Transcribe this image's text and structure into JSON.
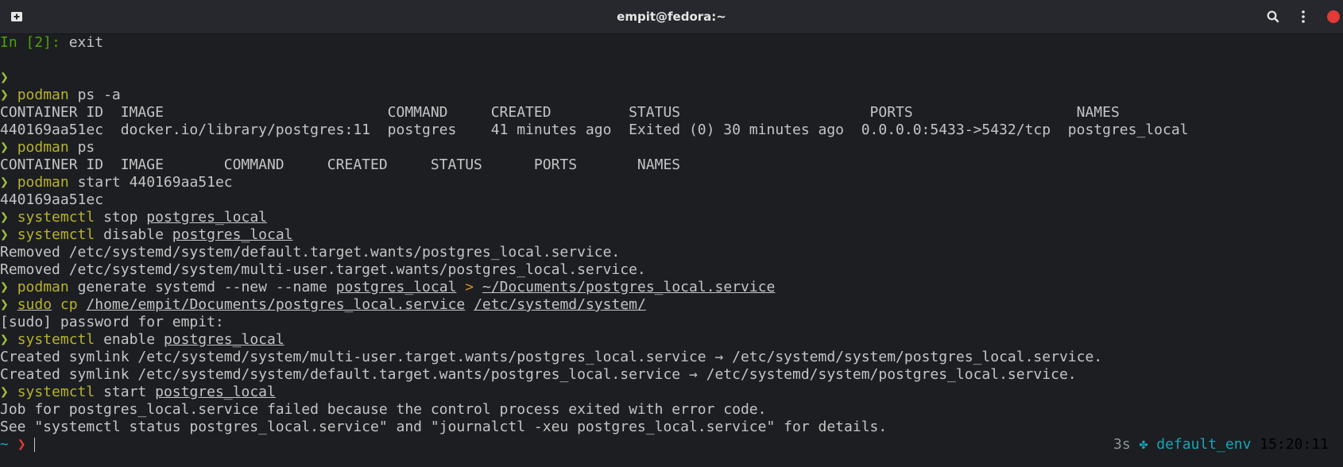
{
  "window": {
    "title": "empit@fedora:~",
    "icons": [
      "new-tab-icon",
      "search-icon",
      "menu-icon",
      "close-icon"
    ]
  },
  "colors": {
    "background": "#1c1e22",
    "titlebar": "#26282d",
    "text": "#c3c6c5",
    "command": "#b7b22c",
    "prompt_chevron": "#a0c13a",
    "ipython_prompt": "#4fa00a",
    "redirect": "#d18a2b",
    "cwd": "#16a6b6",
    "error_chevron": "#e23a35",
    "close_button": "#e23a35"
  },
  "terminal": {
    "ipython_prompt": "In [2]:",
    "ipython_input": "exit",
    "chevron": "❯",
    "cmd1": {
      "program": "podman",
      "args": "ps -a"
    },
    "table1": {
      "header": "CONTAINER ID  IMAGE                          COMMAND     CREATED         STATUS                      PORTS                   NAMES",
      "row": "440169aa51ec  docker.io/library/postgres:11  postgres    41 minutes ago  Exited (0) 30 minutes ago  0.0.0.0:5433->5432/tcp  postgres_local"
    },
    "cmd2": {
      "program": "podman",
      "args": "ps"
    },
    "table2": {
      "header": "CONTAINER ID  IMAGE       COMMAND     CREATED     STATUS      PORTS       NAMES"
    },
    "cmd3": {
      "program": "podman",
      "args": "start 440169aa51ec"
    },
    "out3": "440169aa51ec",
    "cmd4": {
      "program": "systemctl",
      "verb": "stop",
      "target": "postgres_local"
    },
    "cmd5": {
      "program": "systemctl",
      "verb": "disable",
      "target": "postgres_local"
    },
    "out5": [
      "Removed /etc/systemd/system/default.target.wants/postgres_local.service.",
      "Removed /etc/systemd/system/multi-user.target.wants/postgres_local.service."
    ],
    "cmd6": {
      "program": "podman",
      "args": "generate systemd --new --name",
      "target": "postgres_local",
      "redirect": ">",
      "file": "~/Documents/postgres_local.service"
    },
    "cmd7": {
      "program": "sudo",
      "subcommand": "cp",
      "src": "/home/empit/Documents/postgres_local.service",
      "dst": "/etc/systemd/system/"
    },
    "out7": "[sudo] password for empit:",
    "cmd8": {
      "program": "systemctl",
      "verb": "enable",
      "target": "postgres_local"
    },
    "out8": [
      "Created symlink /etc/systemd/system/multi-user.target.wants/postgres_local.service → /etc/systemd/system/postgres_local.service.",
      "Created symlink /etc/systemd/system/default.target.wants/postgres_local.service → /etc/systemd/system/postgres_local.service."
    ],
    "cmd9": {
      "program": "systemctl",
      "verb": "start",
      "target": "postgres_local"
    },
    "out9": [
      "Job for postgres_local.service failed because the control process exited with error code.",
      "See \"systemctl status postgres_local.service\" and \"journalctl -xeu postgres_local.service\" for details."
    ],
    "current_prompt": {
      "cwd": "~",
      "chevron": "❯"
    },
    "right_prompt": {
      "duration": "3s",
      "env_icon": "✤",
      "env": "default_env",
      "time": "15:20:11"
    }
  }
}
